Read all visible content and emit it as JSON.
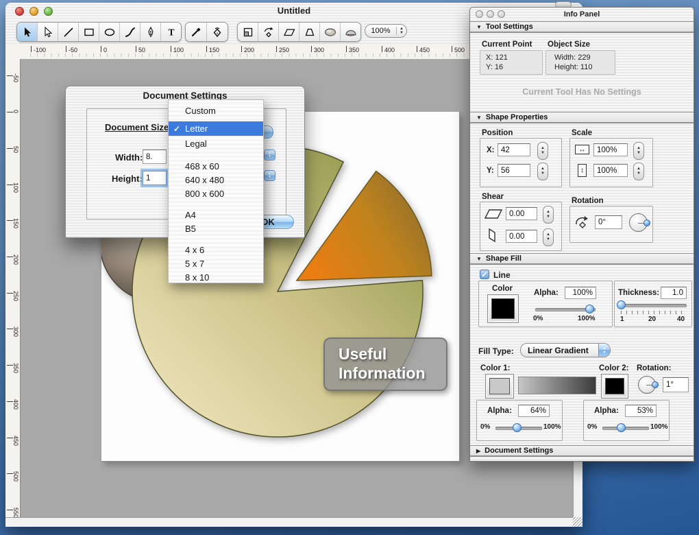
{
  "window": {
    "title": "Untitled",
    "zoom": "100%",
    "h_ruler": [
      "-100",
      "-50",
      "0",
      "50",
      "100",
      "150",
      "200",
      "250",
      "300",
      "350",
      "400",
      "450",
      "500"
    ],
    "v_ruler": [
      "-50",
      "0",
      "50",
      "100",
      "150",
      "200",
      "250",
      "300",
      "350",
      "400",
      "450",
      "500",
      "550"
    ]
  },
  "icons": {
    "toolbar": [
      "select",
      "direct-select",
      "line",
      "rectangle",
      "ellipse",
      "brush",
      "pen",
      "text",
      "eyedropper",
      "vector-pen",
      "scale",
      "rotate",
      "shear",
      "perspective",
      "filled-ellipse",
      "dome"
    ]
  },
  "dialog": {
    "title": "Document Settings",
    "size_label": "Document Size",
    "width_label": "Width:",
    "width_value": "8.",
    "height_label": "Height:",
    "height_value": "1",
    "ok": "OK",
    "menu": {
      "checkmark": "✓",
      "items": [
        {
          "label": "Custom",
          "selected": false
        },
        {
          "label": "Letter",
          "selected": true
        },
        {
          "label": "Legal",
          "selected": false
        },
        {
          "label": "468 x 60",
          "selected": false
        },
        {
          "label": "640 x 480",
          "selected": false
        },
        {
          "label": "800 x 600",
          "selected": false
        },
        {
          "label": "A4",
          "selected": false
        },
        {
          "label": "B5",
          "selected": false
        },
        {
          "label": "4 x 6",
          "selected": false
        },
        {
          "label": "5 x 7",
          "selected": false
        },
        {
          "label": "8 x 10",
          "selected": false
        }
      ]
    }
  },
  "drawing": {
    "label_line1": "Useful",
    "label_line2": "Information",
    "pie_color_light": "#f2e9c3",
    "pie_color_dark": "#85903e",
    "slice_color_orange": "#ec7d13",
    "slice_color_dark": "#8c6e2d",
    "sphere_color": "#8a8177",
    "label_bg": "#919191"
  },
  "info_panel": {
    "title": "Info Panel",
    "tool_settings": {
      "header": "Tool Settings",
      "current_point_label": "Current Point",
      "x_label": "X:",
      "x_value": "121",
      "y_label": "Y:",
      "y_value": "16",
      "object_size_label": "Object Size",
      "width_label": "Width:",
      "width_value": "229",
      "height_label": "Height:",
      "height_value": "110",
      "no_settings": "Current Tool Has No Settings"
    },
    "shape_properties": {
      "header": "Shape Properties",
      "position_label": "Position",
      "x_label": "X:",
      "x_value": "42",
      "y_label": "Y:",
      "y_value": "56",
      "scale_label": "Scale",
      "scale_h": "100%",
      "scale_v": "100%",
      "shear_label": "Shear",
      "shear_h": "0.00",
      "shear_v": "0.00",
      "rotation_label": "Rotation",
      "rotation_value": "0°"
    },
    "shape_fill": {
      "header": "Shape Fill",
      "line_label": "Line",
      "color_label": "Color",
      "alpha_label": "Alpha:",
      "line_alpha": "100%",
      "min_label": "0%",
      "max_label": "100%",
      "thickness_label": "Thickness:",
      "thickness_value": "1.0",
      "tick_1": "1",
      "tick_20": "20",
      "tick_40": "40",
      "fill_type_label": "Fill Type:",
      "fill_type_value": "Linear Gradient",
      "color1_label": "Color 1:",
      "color2_label": "Color 2:",
      "rotation_label": "Rotation:",
      "rotation_value": "1°",
      "alpha1_label": "Alpha:",
      "alpha1_value": "64%",
      "alpha2_label": "Alpha:",
      "alpha2_value": "53%"
    },
    "document_settings": {
      "header": "Document Settings"
    }
  },
  "colors": {
    "accent_blue": "#3c7add",
    "aqua_button": "#78b0e8",
    "canvas_gray": "#a8a8a8",
    "desktop_blue": "#3c6ca8"
  }
}
